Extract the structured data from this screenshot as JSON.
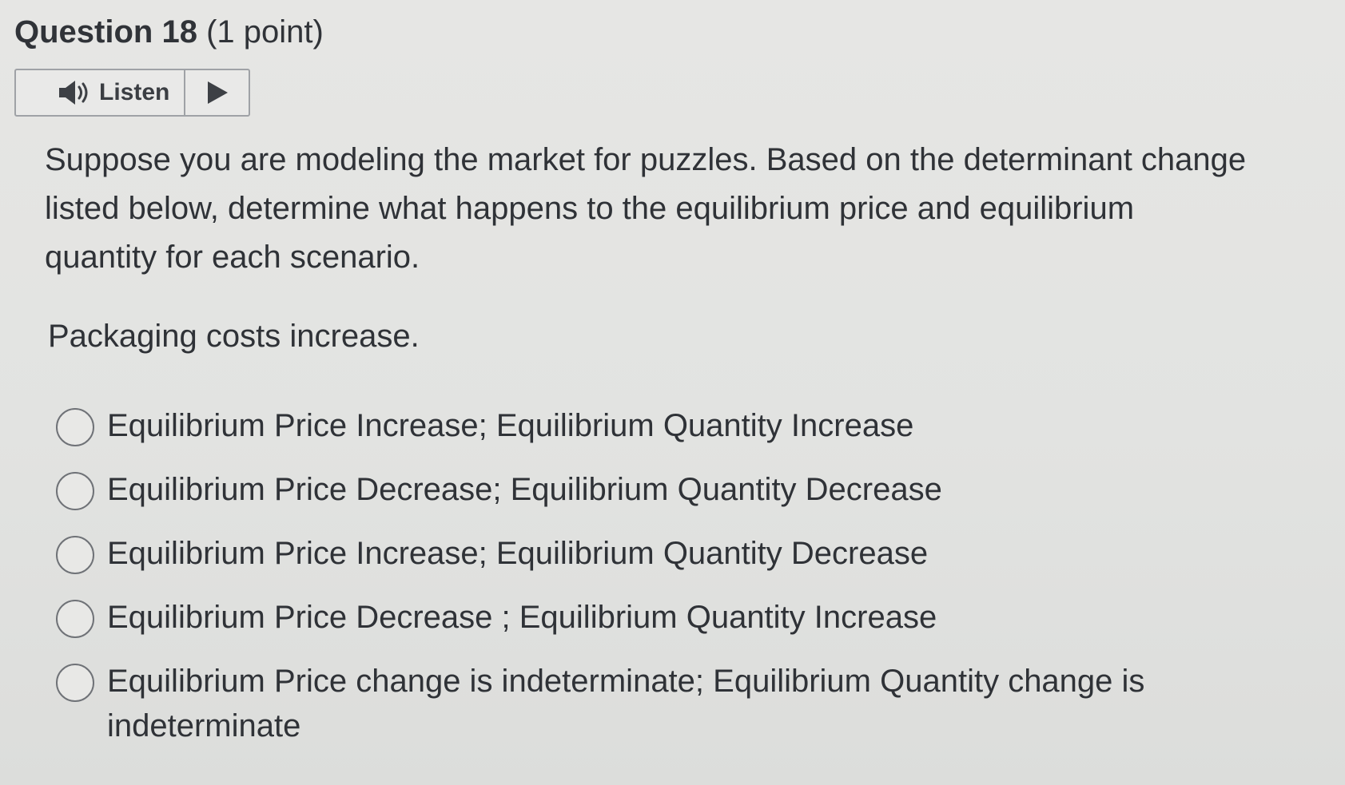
{
  "question": {
    "number_label": "Question 18",
    "points_label": "(1 point)"
  },
  "listen": {
    "label": "Listen",
    "speaker_icon": "speaker-icon",
    "play_icon": "play-icon"
  },
  "prompt": {
    "lines": [
      "Suppose you are modeling the market for puzzles. Based on the determinant change",
      "listed below, determine what happens to the equilibrium price and equilibrium",
      "quantity for each scenario."
    ]
  },
  "scenario": "Packaging costs increase.",
  "options": [
    {
      "label": "Equilibrium Price Increase; Equilibrium Quantity Increase"
    },
    {
      "label": "Equilibrium Price Decrease; Equilibrium Quantity Decrease"
    },
    {
      "label": "Equilibrium Price Increase; Equilibrium Quantity Decrease"
    },
    {
      "label": "Equilibrium Price Decrease ; Equilibrium Quantity Increase"
    },
    {
      "label": "Equilibrium Price change is indeterminate; Equilibrium Quantity change is indeterminate"
    }
  ]
}
